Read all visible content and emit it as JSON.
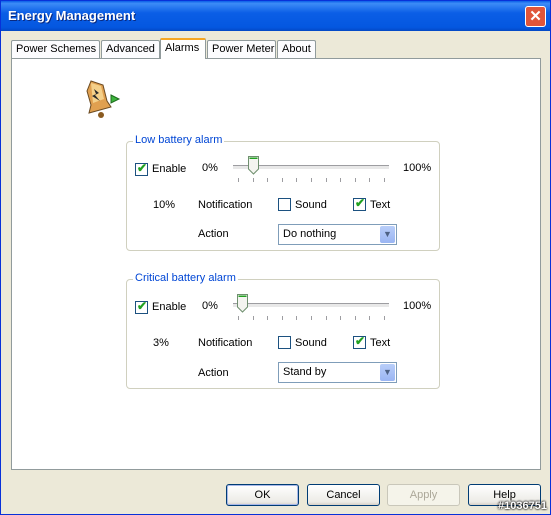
{
  "window": {
    "title": "Energy Management",
    "close_glyph": "✕"
  },
  "tabs": [
    {
      "label": "Power Schemes"
    },
    {
      "label": "Advanced"
    },
    {
      "label": "Alarms",
      "active": true
    },
    {
      "label": "Power Meter"
    },
    {
      "label": "About"
    }
  ],
  "icon": {
    "name": "battery-bell-icon"
  },
  "low_alarm": {
    "title": "Low battery alarm",
    "enable_label": "Enable",
    "enabled": true,
    "min_label": "0%",
    "max_label": "100%",
    "level": "10%",
    "level_fraction": 0.1,
    "notification_label": "Notification",
    "sound_label": "Sound",
    "sound_checked": false,
    "text_label": "Text",
    "text_checked": true,
    "action_label": "Action",
    "action_value": "Do nothing"
  },
  "critical_alarm": {
    "title": "Critical battery alarm",
    "enable_label": "Enable",
    "enabled": true,
    "min_label": "0%",
    "max_label": "100%",
    "level": "3%",
    "level_fraction": 0.03,
    "notification_label": "Notification",
    "sound_label": "Sound",
    "sound_checked": false,
    "text_label": "Text",
    "text_checked": true,
    "action_label": "Action",
    "action_value": "Stand by"
  },
  "buttons": {
    "ok": "OK",
    "cancel": "Cancel",
    "apply": "Apply",
    "help": "Help"
  },
  "watermark": "#1036751",
  "colors": {
    "titlebar": "#0a5fe8",
    "group_title": "#0046d5",
    "check": "#21a121"
  }
}
